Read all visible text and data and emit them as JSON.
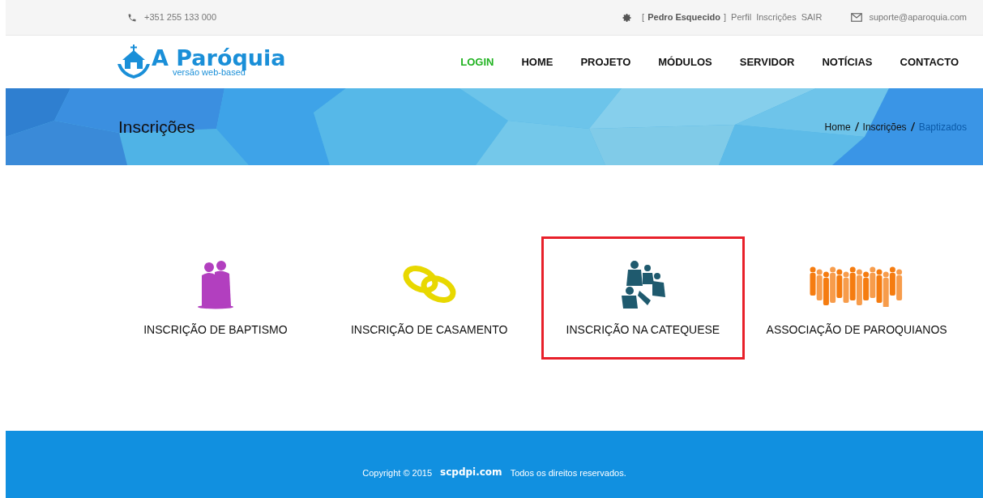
{
  "top_bar": {
    "phone": "+351 255 133 000",
    "user_open": "[",
    "user_name": "Pedro Esquecido",
    "user_close": "]",
    "links": [
      "Perfil",
      "Inscrições",
      "SAIR"
    ],
    "email": "suporte@aparoquia.com"
  },
  "logo": {
    "title": "A Paróquia",
    "subtitle": "versão web-based"
  },
  "nav": [
    {
      "label": "LOGIN",
      "selected": true
    },
    {
      "label": "HOME",
      "selected": false
    },
    {
      "label": "PROJETO",
      "selected": false
    },
    {
      "label": "MÓDULOS",
      "selected": false
    },
    {
      "label": "SERVIDOR",
      "selected": false
    },
    {
      "label": "NOTÍCIAS",
      "selected": false
    },
    {
      "label": "CONTACTO",
      "selected": false
    }
  ],
  "hero": {
    "title": "Inscrições",
    "breadcrumb": [
      {
        "label": "Home",
        "selected": false
      },
      {
        "label": "Inscrições",
        "selected": false
      },
      {
        "label": "Baptizados",
        "selected": true
      }
    ]
  },
  "options": [
    {
      "kind": "couple",
      "label": "INSCRIÇÃO DE BAPTISMO",
      "selected": false,
      "color": "#b23fbf"
    },
    {
      "kind": "rings",
      "label": "INSCRIÇÃO DE CASAMENTO",
      "selected": false,
      "color": "#e8d800"
    },
    {
      "kind": "group",
      "label": "INSCRIÇÃO NA CATEQUESE",
      "selected": true,
      "color": "#1f5a6e"
    },
    {
      "kind": "crowd",
      "label": "ASSOCIAÇÃO DE PAROQUIANOS",
      "selected": false,
      "color": "#f57c10"
    }
  ],
  "footer": {
    "copyright": "Copyright © 2015",
    "brand": "scpdpi.com",
    "rights": "Todos os direitos reservados."
  }
}
